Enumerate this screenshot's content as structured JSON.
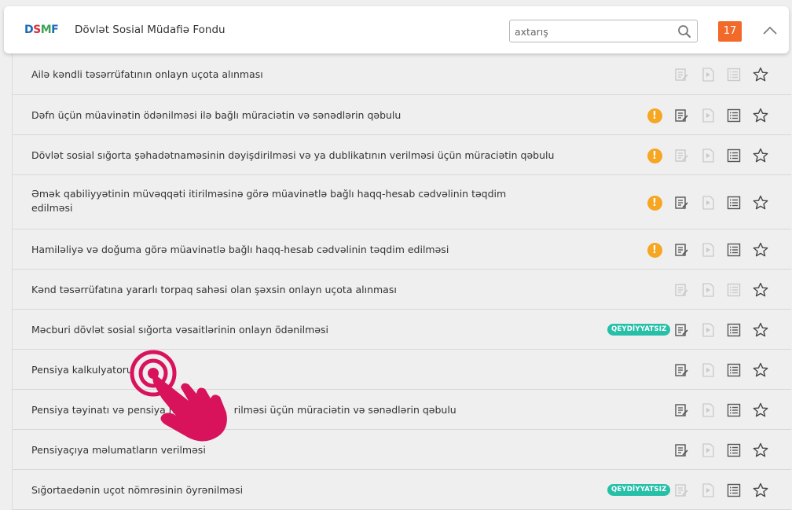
{
  "header": {
    "logo": {
      "part1": "D",
      "part2": "S",
      "part3": "M",
      "part4": "F"
    },
    "org_name": "Dövlət Sosial Müdafiə Fondu",
    "search_placeholder": "axtarış",
    "search_value": "",
    "count": "17"
  },
  "colors": {
    "accent_orange": "#f26a2a",
    "warning": "#f5a623",
    "badge_green": "#26bfa8",
    "hand": "#d8125b"
  },
  "services": [
    {
      "title": "Ailə kəndli təsərrüfatının onlayn uçota alınması",
      "warning": false,
      "badge": "",
      "form_active": false,
      "list_active": false
    },
    {
      "title": "Dəfn üçün müavinətin ödənilməsi ilə bağlı müraciətin və sənədlərin qəbulu",
      "warning": true,
      "badge": "",
      "form_active": true,
      "list_active": true
    },
    {
      "title": "Dövlət sosial sığorta şəhadətnaməsinin dəyişdirilməsi və ya dublikatının verilməsi üçün müraciətin qəbulu",
      "warning": true,
      "badge": "",
      "form_active": false,
      "list_active": true
    },
    {
      "title": "Əmək qabiliyyətinin müvəqqəti itirilməsinə görə müavinətlə bağlı haqq-hesab cədvəlinin təqdim",
      "title_line2": "edilməsi",
      "warning": true,
      "badge": "",
      "form_active": true,
      "list_active": true
    },
    {
      "title": "Hamiləliyə və doğuma görə müavinətlə bağlı haqq-hesab cədvəlinin təqdim edilməsi",
      "warning": true,
      "badge": "",
      "form_active": true,
      "list_active": true
    },
    {
      "title": "Kənd təsərrüfatına yararlı torpaq sahəsi olan şəxsin onlayn uçota alınması",
      "warning": false,
      "badge": "",
      "form_active": false,
      "list_active": false
    },
    {
      "title": "Məcburi dövlət sosial sığorta vəsaitlərinin onlayn ödənilməsi",
      "warning": false,
      "badge": "QEYDİYYATSIZ",
      "form_active": true,
      "list_active": true
    },
    {
      "title": "Pensiya kalkulyatoru",
      "warning": false,
      "badge": "",
      "form_active": true,
      "list_active": true
    },
    {
      "title": "Pensiya təyinatı və pensiya növü",
      "title_tail": "rilməsi üçün müraciətin və sənədlərin qəbulu",
      "warning": false,
      "badge": "",
      "form_active": true,
      "list_active": true
    },
    {
      "title": "Pensiyaçıya məlumatların verilməsi",
      "warning": false,
      "badge": "",
      "form_active": true,
      "list_active": true
    },
    {
      "title": "Sığortaedənin uçot nömrəsinin öyrənilməsi",
      "warning": false,
      "badge": "QEYDİYYATSIZ",
      "form_active": false,
      "list_active": true
    }
  ]
}
